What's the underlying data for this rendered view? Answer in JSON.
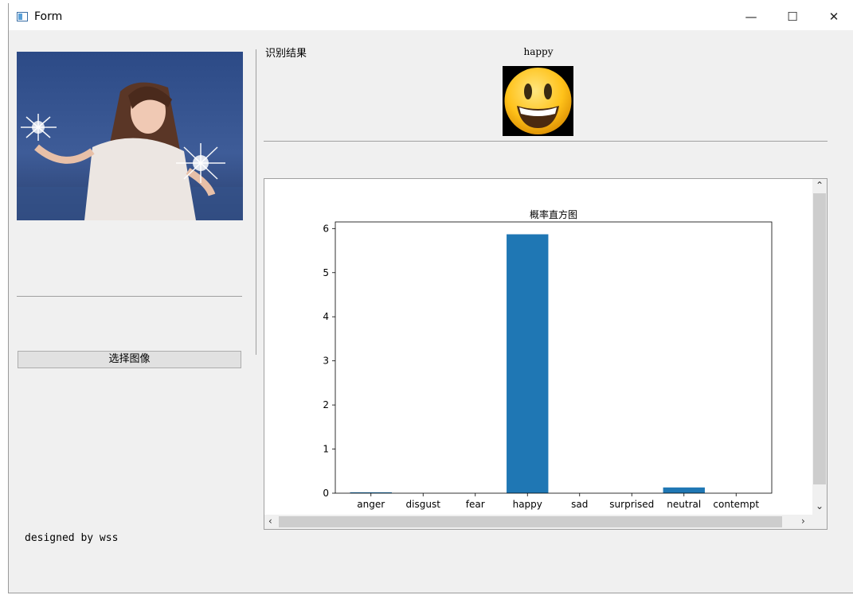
{
  "window": {
    "title": "Form",
    "minimize": "—",
    "maximize": "☐",
    "close": "✕"
  },
  "left_panel": {
    "select_button": "选择图像",
    "footer": "designed by wss"
  },
  "result": {
    "label": "识别结果",
    "emotion": "happy"
  },
  "colors": {
    "bar": "#1f77b4",
    "window_bg": "#f0f0f0"
  },
  "chart_data": {
    "type": "bar",
    "title": "概率直方图",
    "categories": [
      "anger",
      "disgust",
      "fear",
      "happy",
      "sad",
      "surprised",
      "neutral",
      "contempt"
    ],
    "values": [
      0.02,
      0,
      0,
      5.87,
      0,
      0,
      0.13,
      0
    ],
    "ylim": [
      0,
      6.15
    ],
    "yticks": [
      0,
      1,
      2,
      3,
      4,
      5,
      6
    ],
    "xlabel": "",
    "ylabel": "",
    "grid": false
  }
}
